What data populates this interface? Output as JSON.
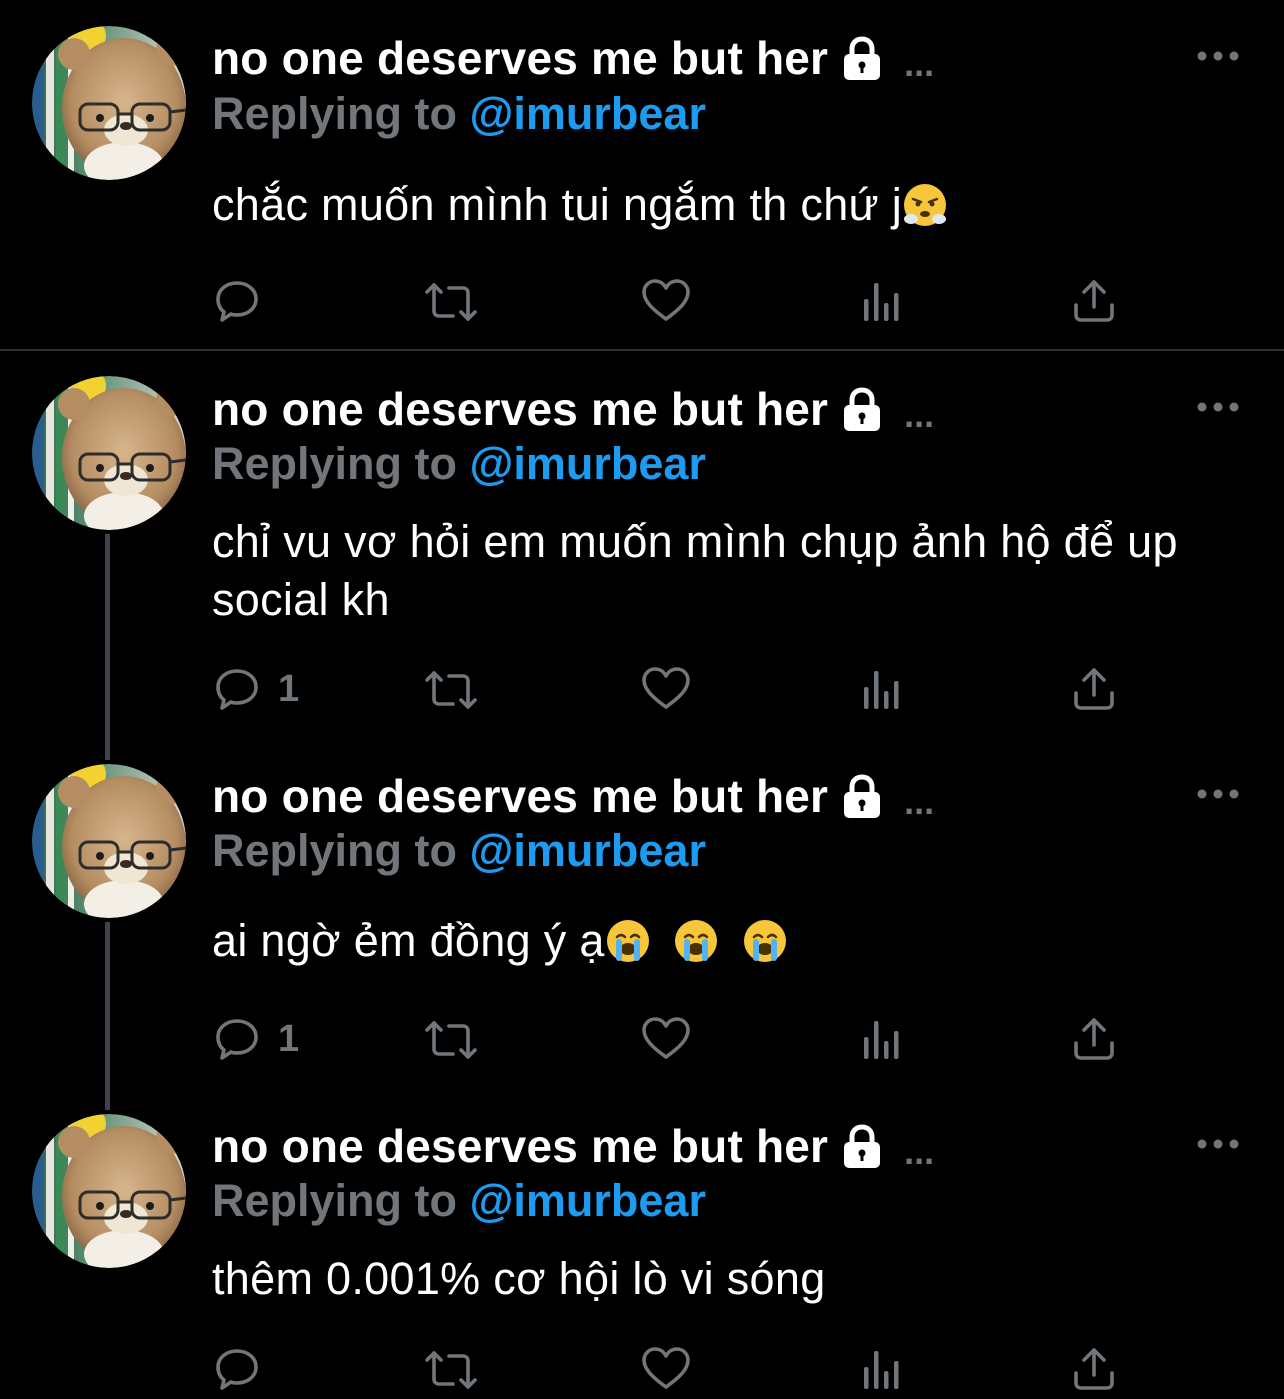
{
  "theme": {
    "background": "#000000",
    "text": "#ffffff",
    "secondary": "#71767b",
    "accent": "#1d9bf0",
    "divider": "#2f3336"
  },
  "tweets": [
    {
      "name": "no one deserves me but her",
      "lock_icon": "lock-icon",
      "name_more": "...",
      "replying_prefix": "Replying to",
      "mention": "@imurbear",
      "text": "chắc muốn mình tui ngắm th chứ j",
      "text_emoji": "😤",
      "reply_count": "",
      "icons": [
        "reply-icon",
        "retweet-icon",
        "like-icon",
        "views-icon",
        "share-icon"
      ]
    },
    {
      "name": "no one deserves me but her",
      "lock_icon": "lock-icon",
      "name_more": "...",
      "replying_prefix": "Replying to",
      "mention": "@imurbear",
      "text": "chỉ vu vơ hỏi em muốn mình chụp ảnh hộ để up social kh",
      "reply_count": "1",
      "icons": [
        "reply-icon",
        "retweet-icon",
        "like-icon",
        "views-icon",
        "share-icon"
      ]
    },
    {
      "name": "no one deserves me but her",
      "lock_icon": "lock-icon",
      "name_more": "...",
      "replying_prefix": "Replying to",
      "mention": "@imurbear",
      "text": "ai ngờ ẻm đồng ý ạ",
      "text_emoji": "😭 😭 😭",
      "reply_count": "1",
      "icons": [
        "reply-icon",
        "retweet-icon",
        "like-icon",
        "views-icon",
        "share-icon"
      ]
    },
    {
      "name": "no one deserves me but her",
      "lock_icon": "lock-icon",
      "name_more": "...",
      "replying_prefix": "Replying to",
      "mention": "@imurbear",
      "text": "thêm 0.001% cơ hội lò vi sóng",
      "reply_count": "",
      "icons": [
        "reply-icon",
        "retweet-icon",
        "like-icon",
        "views-icon",
        "share-icon"
      ]
    }
  ]
}
